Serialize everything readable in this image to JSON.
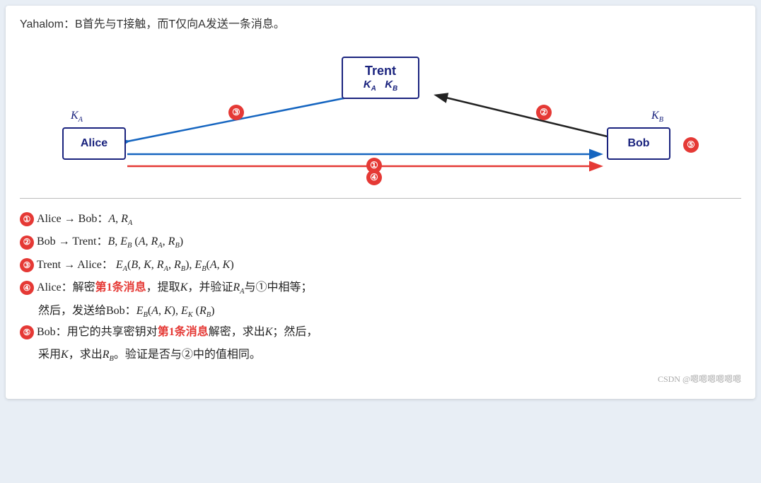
{
  "header": {
    "text": "Yahalom：B首先与T接触，而T仅向A发送一条消息。"
  },
  "diagram": {
    "trent_label": "Trent",
    "trent_keys": "K",
    "trent_ka": "A",
    "trent_kb": "B",
    "alice_label": "Alice",
    "bob_label": "Bob",
    "key_alice": "K",
    "key_alice_sub": "A",
    "key_bob": "K",
    "key_bob_sub": "B",
    "badge1": "①",
    "badge2": "②",
    "badge3": "③",
    "badge4": "④",
    "badge5": "⑤"
  },
  "steps": [
    {
      "num": "①",
      "text_parts": [
        "Alice → Bob：",
        " A,R",
        "A"
      ]
    },
    {
      "num": "②",
      "text_parts": [
        "Bob → Trent：",
        " B,E",
        "B",
        "(A,R",
        "A",
        ",R",
        "B",
        ")"
      ]
    },
    {
      "num": "③",
      "text_parts": [
        "Trent → Alice：",
        "  E",
        "A",
        "(B,K,R",
        "A",
        ",R",
        "B",
        "),E",
        "B",
        "(A,K)"
      ]
    },
    {
      "num": "④",
      "line1": "Alice：解密第1条消息，提取K，并验证R",
      "line1_sub": "A",
      "line1_end": "与①中相等；",
      "line2_pre": "然后，发送给Bob：",
      "line2_math": " E",
      "line2_b": "B",
      "line2_mid": "(A,K), E",
      "line2_k": "K",
      "line2_end": " (R",
      "line2_rb": "B",
      "line2_close": ")"
    },
    {
      "num": "⑤",
      "line1": "Bob：用它的共享密钥对第1条消息解密，求出K；然后，",
      "line2": "采用K，求出R",
      "line2_sub": "B",
      "line2_end": "。验证是否与②中的值相同。"
    }
  ],
  "watermark": "CSDN @嗯嗯嗯嗯嗯嗯"
}
